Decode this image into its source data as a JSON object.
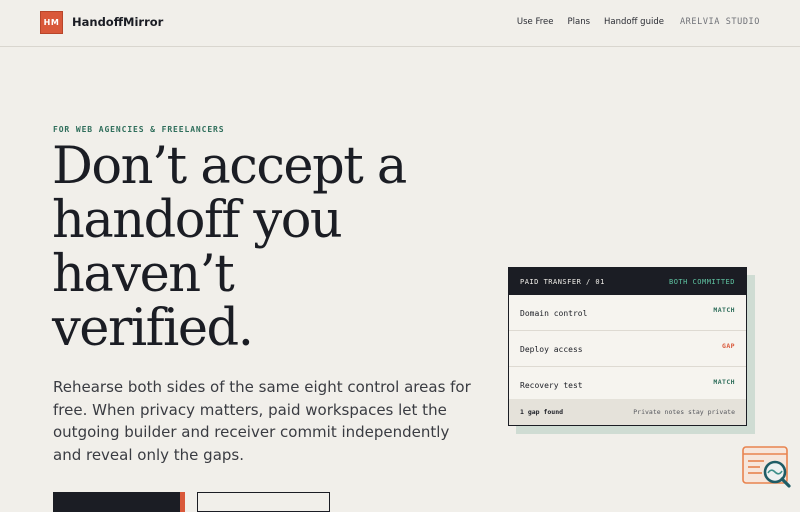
{
  "brand": {
    "mark": "HM",
    "name": "HandoffMirror"
  },
  "nav": {
    "items": [
      "Use Free",
      "Plans",
      "Handoff guide"
    ],
    "studio": "ARELVIA STUDIO"
  },
  "hero": {
    "eyebrow": "FOR WEB AGENCIES & FREELANCERS",
    "headline_lines": [
      "Don’t accept a",
      "handoff you",
      "haven’t",
      "verified."
    ],
    "lede": "Rehearse both sides of the same eight control areas for free. When privacy matters, paid workspaces let the outgoing builder and receiver commit independently and reveal only the gaps."
  },
  "card": {
    "title": "PAID TRANSFER / 01",
    "status": "BOTH COMMITTED",
    "rows": [
      {
        "label": "Domain control",
        "tag": "MATCH"
      },
      {
        "label": "Deploy access",
        "tag": "GAP"
      },
      {
        "label": "Recovery test",
        "tag": "MATCH"
      }
    ],
    "footer_left": "1 gap found",
    "footer_right": "Private notes stay private"
  },
  "colors": {
    "accent": "#d9583a",
    "ink": "#1b1d24",
    "green": "#2f6e5b",
    "background": "#f1efea"
  },
  "icons": {
    "widget": "search-magnifier-icon"
  }
}
